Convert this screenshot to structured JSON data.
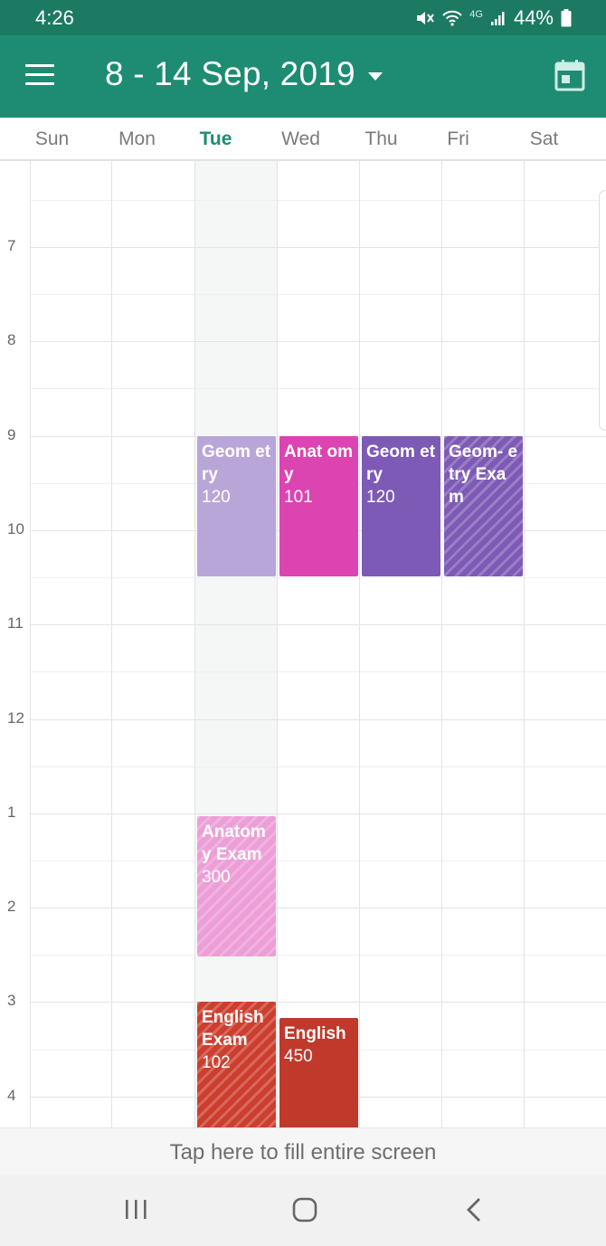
{
  "status_bar": {
    "time": "4:26",
    "network": "4G",
    "battery": "44%"
  },
  "app_bar": {
    "date_range": "8 - 14 Sep, 2019",
    "menu_icon": "hamburger-menu-icon",
    "calendar_icon": "calendar-today-icon"
  },
  "days": [
    {
      "label": "Sun",
      "today": false
    },
    {
      "label": "Mon",
      "today": false
    },
    {
      "label": "Tue",
      "today": true
    },
    {
      "label": "Wed",
      "today": false
    },
    {
      "label": "Thu",
      "today": false
    },
    {
      "label": "Fri",
      "today": false
    },
    {
      "label": "Sat",
      "today": false
    }
  ],
  "hours": [
    "7",
    "8",
    "9",
    "10",
    "11",
    "12",
    "1",
    "2",
    "3",
    "4"
  ],
  "events": [
    {
      "title": "Geom etry",
      "number": "120",
      "day": "Tue",
      "start": "9:00",
      "end": "10:30",
      "color": "#b9a6d8",
      "exam": false
    },
    {
      "title": "Anat omy",
      "number": "101",
      "day": "Wed",
      "start": "9:00",
      "end": "10:30",
      "color": "#dc44b2",
      "exam": false
    },
    {
      "title": "Geom etry",
      "number": "120",
      "day": "Thu",
      "start": "9:00",
      "end": "10:30",
      "color": "#7d5ab5",
      "exam": false
    },
    {
      "title": "Geom- etry Exam",
      "number": "",
      "day": "Fri",
      "start": "9:00",
      "end": "10:30",
      "color": "#7d5ab5",
      "exam": true
    },
    {
      "title": "Anatom y Exam",
      "number": "300",
      "day": "Tue",
      "start": "13:00",
      "end": "14:30",
      "color": "#ec9ed6",
      "exam": true
    },
    {
      "title": "English Exam",
      "number": "102",
      "day": "Tue",
      "start": "15:00",
      "end": "16:30",
      "color": "#cc3e2e",
      "exam": true
    },
    {
      "title": "English",
      "number": "450",
      "day": "Wed",
      "start": "15:10",
      "end": "16:30",
      "color": "#c0392b",
      "exam": false
    }
  ],
  "fill_screen_text": "Tap here to fill entire screen",
  "nav_bar": {
    "recents_icon": "recent-apps-icon",
    "home_icon": "home-icon",
    "back_icon": "back-icon"
  },
  "colors": {
    "primary": "#1e8c73",
    "status_bar": "#1c7a62",
    "today_shade": "#f4f7f6"
  }
}
